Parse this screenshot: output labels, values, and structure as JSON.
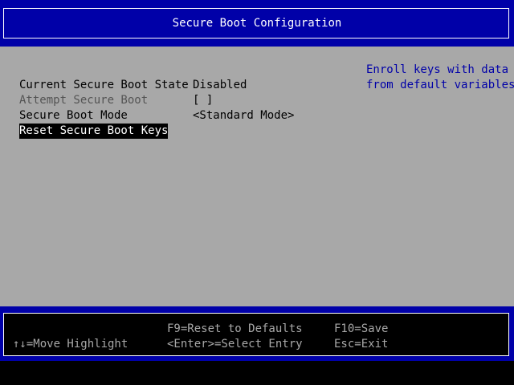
{
  "header": {
    "title": "Secure Boot Configuration"
  },
  "settings": [
    {
      "label": "Current Secure Boot State",
      "value": "Disabled",
      "enabled": true
    },
    {
      "label": "Attempt Secure Boot",
      "value": "[ ]",
      "enabled": false
    },
    {
      "label": "Secure Boot Mode",
      "value": "<Standard Mode>",
      "enabled": true
    },
    {
      "label": "Reset Secure Boot Keys",
      "value": "",
      "enabled": true,
      "selected": true
    }
  ],
  "help": {
    "line1": "Enroll keys with data",
    "line2": "from default variables"
  },
  "footer": {
    "reset_defaults": "F9=Reset to Defaults",
    "save": "F10=Save",
    "move_highlight": "↑↓=Move Highlight",
    "select_entry": "<Enter>=Select Entry",
    "exit": "Esc=Exit"
  },
  "colors": {
    "header_bg": "#0000a8",
    "content_bg": "#a8a8a8",
    "selection_bg": "#000000",
    "help_text": "#0000a8",
    "disabled_text": "#545454"
  }
}
